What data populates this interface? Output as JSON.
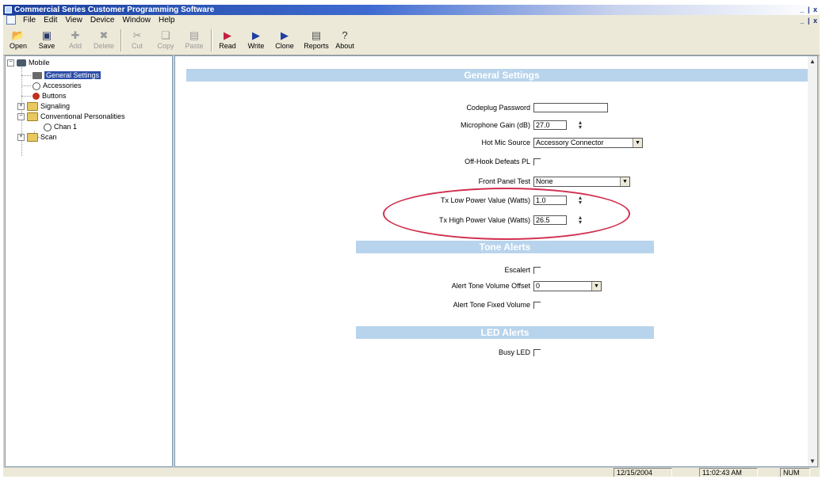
{
  "window": {
    "title": "Commercial Series Customer Programming Software",
    "controls": "_ | x"
  },
  "menu": {
    "items": [
      "File",
      "Edit",
      "View",
      "Device",
      "Window",
      "Help"
    ],
    "mdi_controls": "_ | x"
  },
  "toolbar": {
    "open": "Open",
    "save": "Save",
    "add": "Add",
    "delete": "Delete",
    "cut": "Cut",
    "copy": "Copy",
    "paste": "Paste",
    "read": "Read",
    "write": "Write",
    "clone": "Clone",
    "reports": "Reports",
    "about": "About"
  },
  "tree": {
    "root": "Mobile",
    "items": {
      "general": "General Settings",
      "accessories": "Accessories",
      "buttons": "Buttons",
      "signaling": "Signaling",
      "personalities": "Conventional Personalities",
      "chan1": "Chan 1",
      "scan": "Scan"
    },
    "selected": "General Settings"
  },
  "general_settings": {
    "header": "General Settings",
    "codeplug_password_label": "Codeplug Password",
    "codeplug_password_value": "",
    "mic_gain_label": "Microphone Gain (dB)",
    "mic_gain_value": "27.0",
    "hot_mic_label": "Hot Mic Source",
    "hot_mic_value": "Accessory Connector",
    "off_hook_label": "Off-Hook Defeats PL",
    "off_hook_checked": false,
    "front_panel_label": "Front Panel Test",
    "front_panel_value": "None",
    "tx_low_label": "Tx Low Power Value (Watts)",
    "tx_low_value": "1.0",
    "tx_high_label": "Tx High Power Value (Watts)",
    "tx_high_value": "26.5"
  },
  "tone_alerts": {
    "header": "Tone Alerts",
    "escalert_label": "Escalert",
    "escalert_checked": false,
    "volume_offset_label": "Alert Tone Volume Offset",
    "volume_offset_value": "0",
    "fixed_volume_label": "Alert Tone Fixed Volume",
    "fixed_volume_checked": false
  },
  "led_alerts": {
    "header": "LED Alerts",
    "busy_led_label": "Busy LED",
    "busy_led_checked": false
  },
  "status": {
    "date": "12/15/2004",
    "time": "11:02:43 AM",
    "num": "NUM"
  },
  "colors": {
    "highlight_ellipse": "#d03050",
    "section_header": "#b8d4ec",
    "selection": "#2b4ea8"
  }
}
